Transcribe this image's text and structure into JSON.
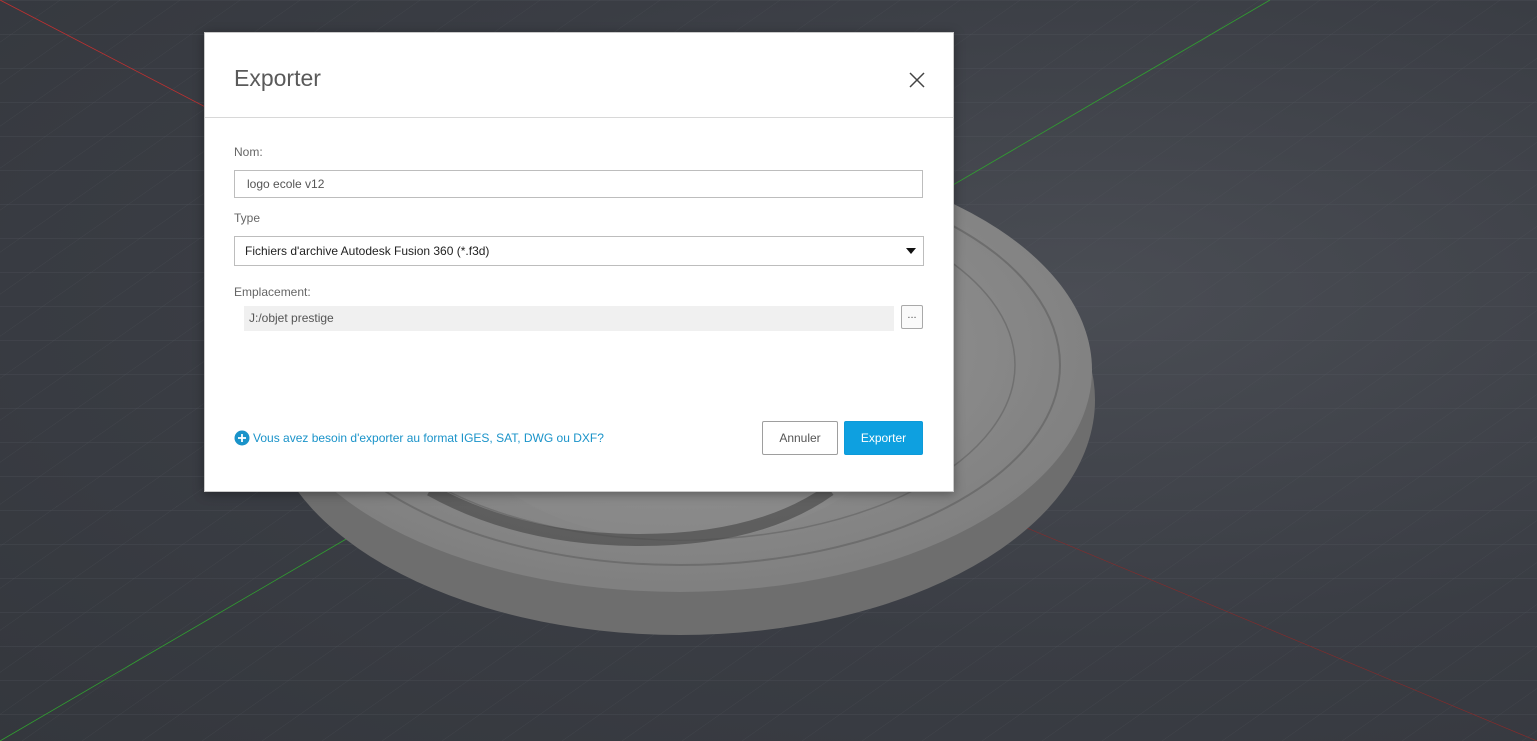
{
  "dialog": {
    "title": "Exporter",
    "name_label": "Nom:",
    "name_value": "logo ecole v12",
    "type_label": "Type",
    "type_selected": "Fichiers d'archive Autodesk Fusion 360 (*.f3d)",
    "location_label": "Emplacement:",
    "location_value": "J:/objet prestige",
    "browse_label": "...",
    "help_link": "Vous avez besoin d'exporter au format IGES, SAT, DWG ou DXF?",
    "cancel_label": "Annuler",
    "export_label": "Exporter"
  },
  "icons": {
    "close": "close-icon",
    "help": "plus-circle-icon",
    "dropdown": "chevron-down-icon"
  },
  "colors": {
    "viewport_bg": "#3a3d44",
    "accent": "#0ea0e0",
    "link": "#1a93c9",
    "axis_x": "#c03030",
    "axis_y": "#30a030"
  }
}
